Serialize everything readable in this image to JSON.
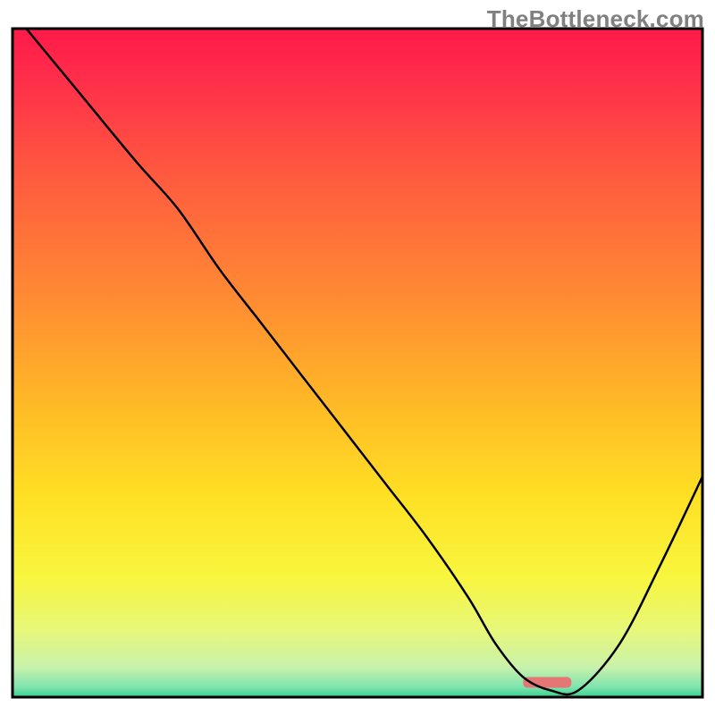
{
  "watermark": "TheBottleneck.com",
  "chart_data": {
    "type": "line",
    "title": "",
    "xlabel": "",
    "ylabel": "",
    "xlim": [
      0,
      100
    ],
    "ylim": [
      0,
      100
    ],
    "background_gradient": {
      "stops": [
        {
          "offset": 0.0,
          "color": "#ff1a4a"
        },
        {
          "offset": 0.08,
          "color": "#ff2f4a"
        },
        {
          "offset": 0.22,
          "color": "#ff5a3f"
        },
        {
          "offset": 0.4,
          "color": "#ff8a33"
        },
        {
          "offset": 0.55,
          "color": "#ffb627"
        },
        {
          "offset": 0.7,
          "color": "#ffe024"
        },
        {
          "offset": 0.82,
          "color": "#f8f63e"
        },
        {
          "offset": 0.9,
          "color": "#e7f77a"
        },
        {
          "offset": 0.955,
          "color": "#c9f2ab"
        },
        {
          "offset": 0.985,
          "color": "#7ee3ae"
        },
        {
          "offset": 1.0,
          "color": "#38d08f"
        }
      ]
    },
    "series": [
      {
        "name": "curve",
        "color": "#000000",
        "stroke_width": 2.5,
        "x": [
          2,
          10,
          18,
          24,
          30,
          36,
          42,
          48,
          54,
          60,
          66,
          70,
          74,
          78,
          82,
          88,
          94,
          100
        ],
        "y": [
          100,
          90,
          80,
          73,
          64,
          56,
          48,
          40,
          32,
          24,
          15,
          8,
          3,
          1,
          1,
          8,
          20,
          33
        ]
      }
    ],
    "marker_bar": {
      "x_start": 74,
      "x_end": 81,
      "color": "#e47773"
    }
  }
}
